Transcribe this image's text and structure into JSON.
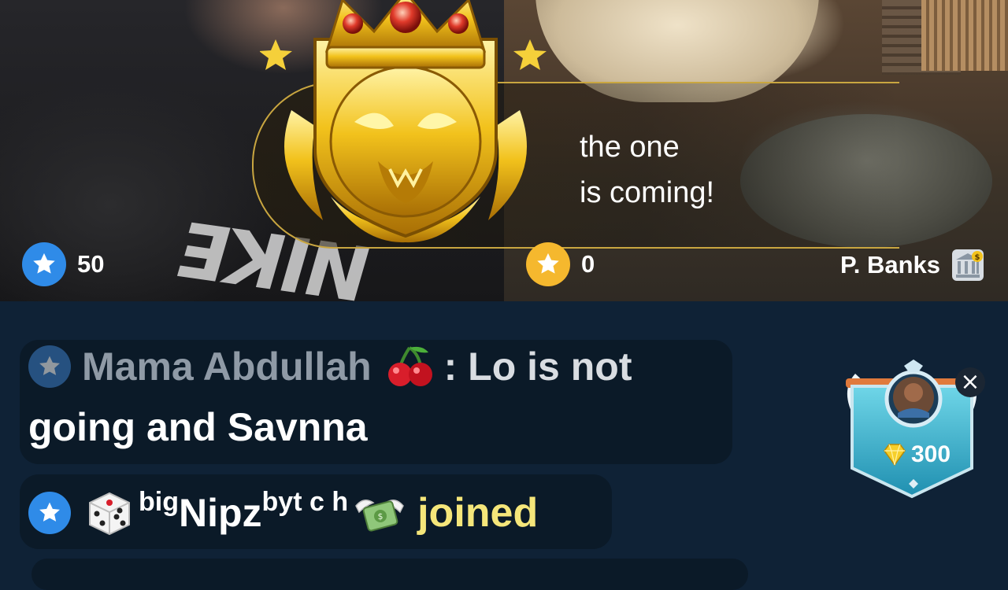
{
  "stream": {
    "left_panel": {
      "score": "50",
      "star_color": "#2f8be8"
    },
    "right_panel": {
      "score": "0",
      "star_color": "#f5b82e",
      "host_name": "P. Banks"
    }
  },
  "arrival_banner": {
    "line1": "the one",
    "line2": "is coming!",
    "icon": "golden-crown-lion-badge-icon",
    "accent_color": "#c9a640"
  },
  "chat": {
    "messages": [
      {
        "sender": "Mama Abdullah",
        "sender_icon": "cherry-icon",
        "text_line1": ": Lo is not",
        "text_line2": "going and Savnna"
      },
      {
        "username_prefix": "big",
        "username_main": "Nipz",
        "username_suffix": "byt c h",
        "icons": [
          "dice-icon",
          "flying-money-icon"
        ],
        "action": "joined",
        "action_color": "#f5e67a"
      }
    ]
  },
  "reward_badge": {
    "amount": "300",
    "icon": "diamond-icon",
    "close": "×"
  },
  "colors": {
    "chat_background": "#0f2236",
    "bubble_background": "#0b1a28"
  }
}
